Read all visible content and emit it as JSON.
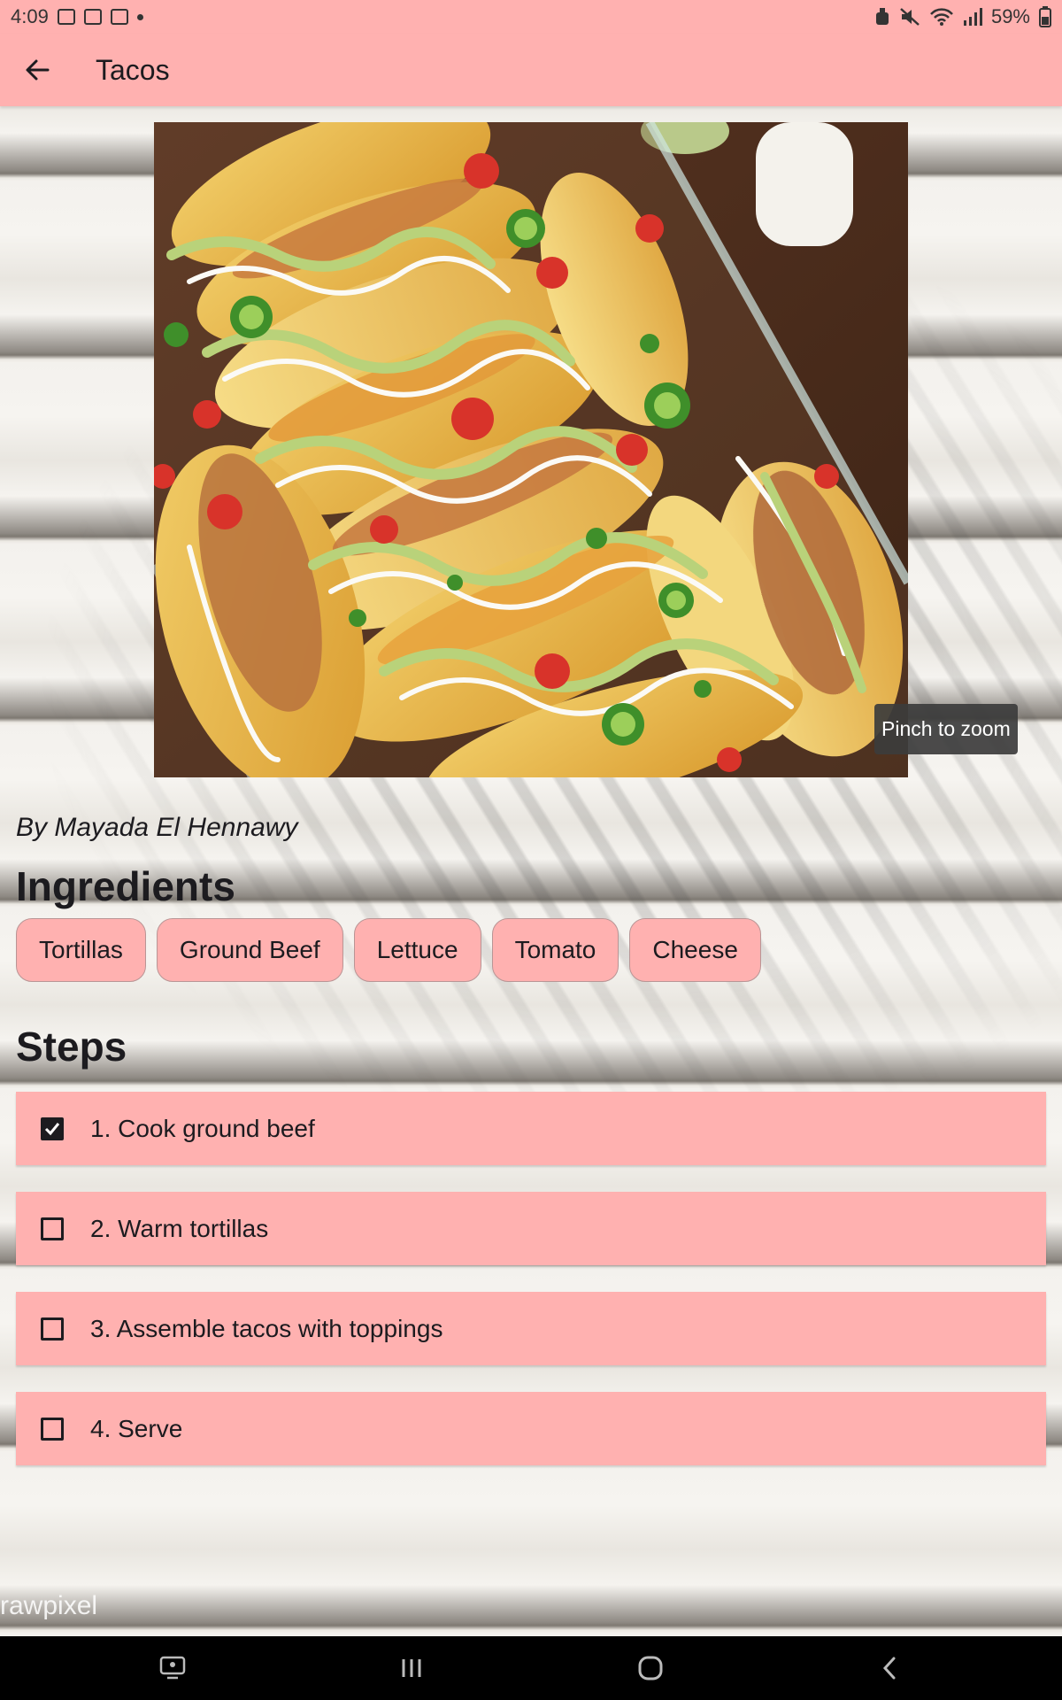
{
  "status_bar": {
    "time": "4:09",
    "battery": "59%"
  },
  "app_bar": {
    "title": "Tacos"
  },
  "hero": {
    "tooltip": "Pinch to zoom"
  },
  "author": "By Mayada El Hennawy",
  "ingredients": {
    "title": "Ingredients",
    "items": [
      "Tortillas",
      "Ground Beef",
      "Lettuce",
      "Tomato",
      "Cheese"
    ]
  },
  "steps": {
    "title": "Steps",
    "items": [
      {
        "label": "1. Cook ground beef",
        "checked": true
      },
      {
        "label": "2. Warm tortillas",
        "checked": false
      },
      {
        "label": "3. Assemble tacos with toppings",
        "checked": false
      },
      {
        "label": "4. Serve",
        "checked": false
      }
    ]
  },
  "watermark": "rawpixel",
  "colors": {
    "accent": "#ffb1b0",
    "text": "#1c1b1f",
    "nav_bar": "#000000"
  }
}
